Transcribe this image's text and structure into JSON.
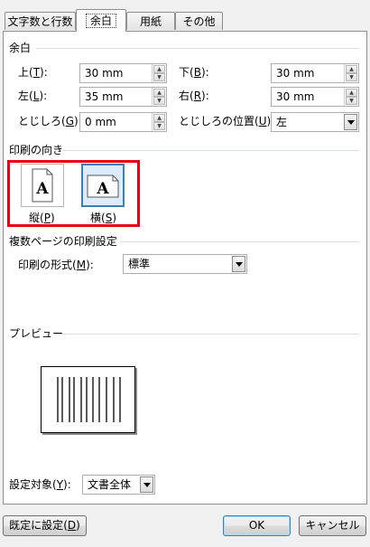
{
  "tabs": [
    "文字数と行数",
    "余白",
    "用紙",
    "その他"
  ],
  "margins": {
    "title": "余白",
    "top": {
      "label": "上",
      "key": "T",
      "value": "30 mm"
    },
    "bottom": {
      "label": "下",
      "key": "B",
      "value": "30 mm"
    },
    "left": {
      "label": "左",
      "key": "L",
      "value": "35 mm"
    },
    "right": {
      "label": "右",
      "key": "R",
      "value": "30 mm"
    },
    "gutter": {
      "label": "とじしろ",
      "key": "G",
      "value": "0 mm"
    },
    "gutter_pos": {
      "label": "とじしろの位置",
      "key": "U",
      "value": "左"
    }
  },
  "orientation": {
    "title": "印刷の向き",
    "portrait": {
      "label": "縦",
      "key": "P"
    },
    "landscape": {
      "label": "横",
      "key": "S"
    },
    "glyph": "A",
    "highlight_color": "#e60012"
  },
  "pages": {
    "title": "複数ページの印刷設定",
    "format_label": "印刷の形式",
    "format_key": "M",
    "format_value": "標準"
  },
  "preview": {
    "title": "プレビュー"
  },
  "apply": {
    "label": "設定対象",
    "key": "Y",
    "value": "文書全体"
  },
  "footer": {
    "default_label": "既定に設定",
    "default_key": "D",
    "ok": "OK",
    "cancel": "キャンセル"
  }
}
